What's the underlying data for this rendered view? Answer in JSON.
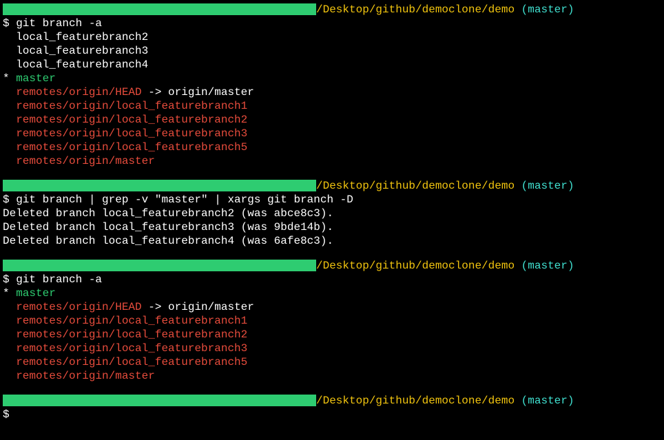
{
  "blocks": [
    {
      "prompt": {
        "path": "/Desktop/github/democlone/demo",
        "branch": "(master)"
      },
      "command": "$ git branch -a",
      "output": [
        {
          "text": "  local_featurebranch2",
          "color": "white"
        },
        {
          "text": "  local_featurebranch3",
          "color": "white"
        },
        {
          "text": "  local_featurebranch4",
          "color": "white"
        },
        {
          "segments": [
            {
              "text": "* ",
              "color": "white"
            },
            {
              "text": "master",
              "color": "green"
            }
          ]
        },
        {
          "segments": [
            {
              "text": "  ",
              "color": "white"
            },
            {
              "text": "remotes/origin/HEAD",
              "color": "red"
            },
            {
              "text": " -> origin/master",
              "color": "white"
            }
          ]
        },
        {
          "text": "  remotes/origin/local_featurebranch1",
          "color": "red"
        },
        {
          "text": "  remotes/origin/local_featurebranch2",
          "color": "red"
        },
        {
          "text": "  remotes/origin/local_featurebranch3",
          "color": "red"
        },
        {
          "text": "  remotes/origin/local_featurebranch5",
          "color": "red"
        },
        {
          "text": "  remotes/origin/master",
          "color": "red"
        }
      ]
    },
    {
      "prompt": {
        "path": "/Desktop/github/democlone/demo",
        "branch": "(master)"
      },
      "command": "$ git branch | grep -v \"master\" | xargs git branch -D",
      "output": [
        {
          "text": "Deleted branch local_featurebranch2 (was abce8c3).",
          "color": "white"
        },
        {
          "text": "Deleted branch local_featurebranch3 (was 9bde14b).",
          "color": "white"
        },
        {
          "text": "Deleted branch local_featurebranch4 (was 6afe8c3).",
          "color": "white"
        }
      ]
    },
    {
      "prompt": {
        "path": "/Desktop/github/democlone/demo",
        "branch": "(master)"
      },
      "command": "$ git branch -a",
      "output": [
        {
          "segments": [
            {
              "text": "* ",
              "color": "white"
            },
            {
              "text": "master",
              "color": "green"
            }
          ]
        },
        {
          "segments": [
            {
              "text": "  ",
              "color": "white"
            },
            {
              "text": "remotes/origin/HEAD",
              "color": "red"
            },
            {
              "text": " -> origin/master",
              "color": "white"
            }
          ]
        },
        {
          "text": "  remotes/origin/local_featurebranch1",
          "color": "red"
        },
        {
          "text": "  remotes/origin/local_featurebranch2",
          "color": "red"
        },
        {
          "text": "  remotes/origin/local_featurebranch3",
          "color": "red"
        },
        {
          "text": "  remotes/origin/local_featurebranch5",
          "color": "red"
        },
        {
          "text": "  remotes/origin/master",
          "color": "red"
        }
      ]
    },
    {
      "prompt": {
        "path": "/Desktop/github/democlone/demo",
        "branch": "(master)"
      },
      "command": "$",
      "output": []
    }
  ]
}
